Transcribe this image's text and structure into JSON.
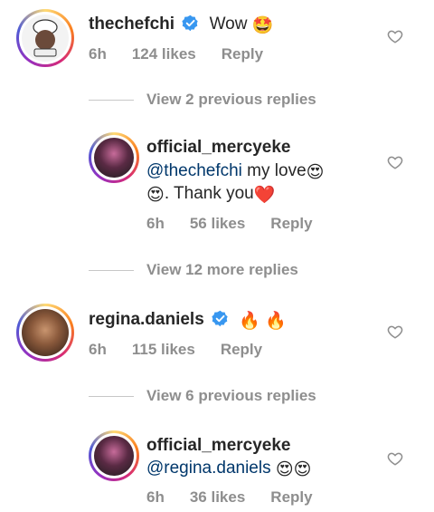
{
  "comments": [
    {
      "username": "thechefchi",
      "verified": true,
      "text": "Wow",
      "emoji": "🤩",
      "time": "6h",
      "likes": "124 likes",
      "reply": "Reply"
    },
    {
      "username": "official_mercyeke",
      "mention": "@thechefchi",
      "text": " my love",
      "emoji_line1": "😍",
      "line2_emoji": "😍",
      "line2_text": ". Thank you",
      "line2_heart": "❤️",
      "time": "6h",
      "likes": "56 likes",
      "reply": "Reply"
    },
    {
      "username": "regina.daniels",
      "verified": true,
      "emoji": "🔥 🔥",
      "time": "6h",
      "likes": "115 likes",
      "reply": "Reply"
    },
    {
      "username": "official_mercyeke",
      "mention": "@regina.daniels",
      "emoji": "😍😍",
      "time": "6h",
      "likes": "36 likes",
      "reply": "Reply"
    }
  ],
  "view_replies": [
    "View 2 previous replies",
    "View 12 more replies",
    "View 6 previous replies"
  ],
  "icons": {
    "like": "heart-outline-icon",
    "verified": "verified-badge-icon"
  },
  "colors": {
    "verified_blue": "#3897f0",
    "mention": "#00376b",
    "meta_gray": "#8e8e8e"
  }
}
